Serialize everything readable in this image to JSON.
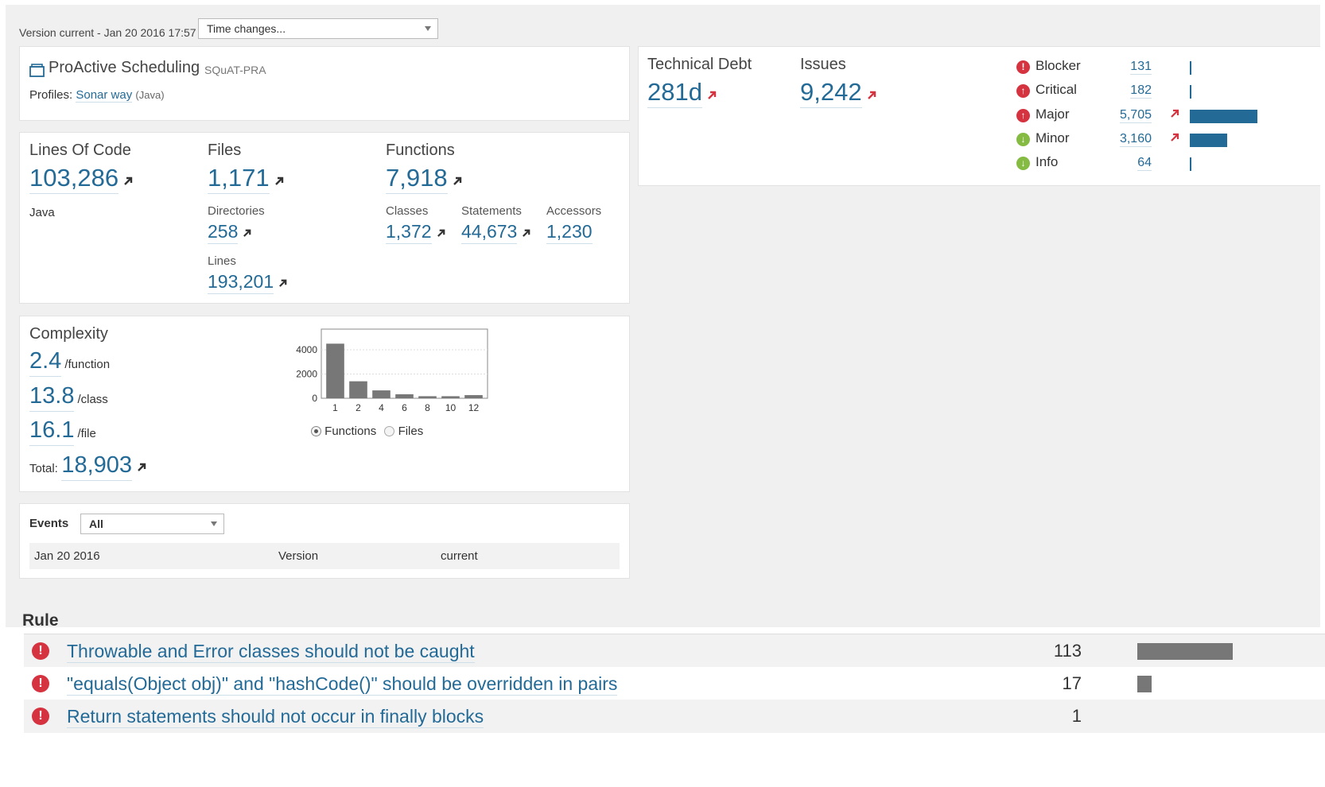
{
  "header": {
    "version_label": "Version current - Jan 20 2016 17:57",
    "time_select": "Time changes..."
  },
  "project": {
    "name": "ProActive Scheduling",
    "key": "SQuAT-PRA",
    "profiles_label": "Profiles:",
    "profile_link": "Sonar way",
    "profile_lang": "(Java)"
  },
  "size": {
    "loc_label": "Lines Of Code",
    "loc_value": "103,286",
    "language": "Java",
    "files_label": "Files",
    "files_value": "1,171",
    "functions_label": "Functions",
    "functions_value": "7,918",
    "directories_label": "Directories",
    "directories_value": "258",
    "lines_label": "Lines",
    "lines_value": "193,201",
    "classes_label": "Classes",
    "classes_value": "1,372",
    "statements_label": "Statements",
    "statements_value": "44,673",
    "accessors_label": "Accessors",
    "accessors_value": "1,230"
  },
  "complexity": {
    "title": "Complexity",
    "per_function": "2.4",
    "per_function_unit": "/function",
    "per_class": "13.8",
    "per_class_unit": "/class",
    "per_file": "16.1",
    "per_file_unit": "/file",
    "total_label": "Total:",
    "total_value": "18,903",
    "radio_functions": "Functions",
    "radio_files": "Files"
  },
  "chart_data": {
    "type": "bar",
    "categories": [
      "1",
      "2",
      "4",
      "6",
      "8",
      "10",
      "12"
    ],
    "values": [
      4500,
      1400,
      650,
      330,
      170,
      170,
      260
    ],
    "ylim": [
      0,
      5700
    ],
    "yticks": [
      0,
      2000,
      4000
    ],
    "grid": true,
    "bar_color": "#777777"
  },
  "events": {
    "label": "Events",
    "filter": "All",
    "rows": [
      {
        "date": "Jan 20 2016",
        "type": "Version",
        "name": "current"
      }
    ]
  },
  "debt": {
    "td_label": "Technical Debt",
    "td_value": "281d",
    "issues_label": "Issues",
    "issues_value": "9,242"
  },
  "severities": [
    {
      "name": "Blocker",
      "count": "131",
      "icon": "blocker-icon",
      "color": "#d4333f",
      "trend": false,
      "bar_fraction": 0.0
    },
    {
      "name": "Critical",
      "count": "182",
      "icon": "critical-icon",
      "color": "#d4333f",
      "trend": false,
      "bar_fraction": 0.0
    },
    {
      "name": "Major",
      "count": "5,705",
      "icon": "major-icon",
      "color": "#d4333f",
      "trend": true,
      "bar_fraction": 1.0
    },
    {
      "name": "Minor",
      "count": "3,160",
      "icon": "minor-icon",
      "color": "#85bb43",
      "trend": true,
      "bar_fraction": 0.55
    },
    {
      "name": "Info",
      "count": "64",
      "icon": "info-icon",
      "color": "#85bb43",
      "trend": false,
      "bar_fraction": 0.0
    }
  ],
  "rules": {
    "header": "Rule",
    "items": [
      {
        "name": "Throwable and Error classes should not be caught",
        "count": "113",
        "bar_fraction": 1.0
      },
      {
        "name": "\"equals(Object obj)\" and \"hashCode()\" should be overridden in pairs",
        "count": "17",
        "bar_fraction": 0.15
      },
      {
        "name": "Return statements should not occur in finally blocks",
        "count": "1",
        "bar_fraction": 0.0
      }
    ]
  },
  "colors": {
    "link": "#236a97",
    "trend_up": "#d4333f",
    "blocker": "#d4333f",
    "minor": "#85bb43",
    "bar": "#236a97"
  }
}
